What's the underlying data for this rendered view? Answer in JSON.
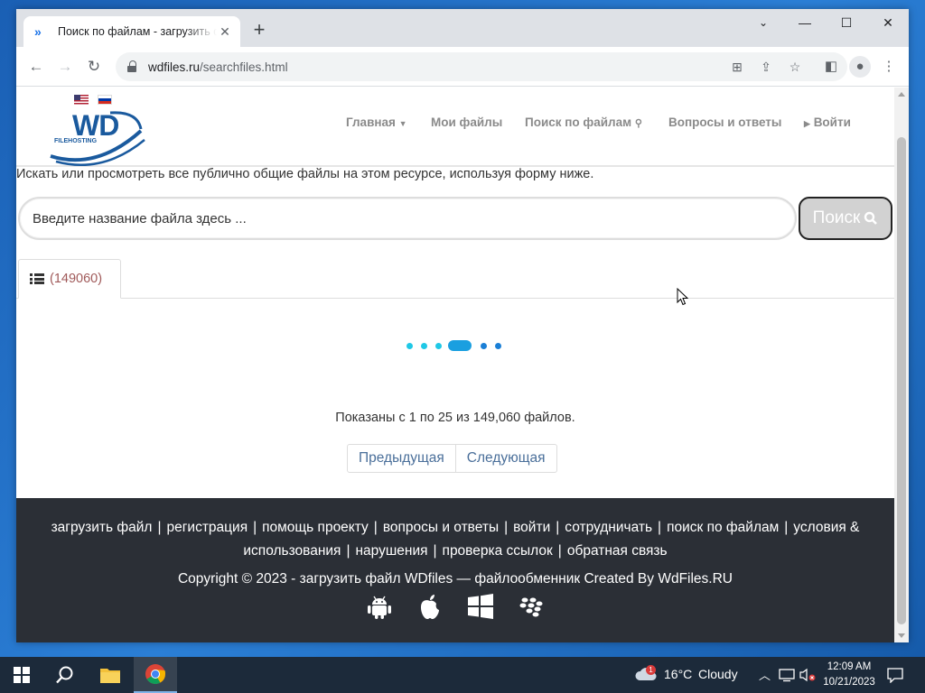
{
  "browser": {
    "tab_title": "Поиск по файлам - загрузить файл",
    "url_host": "wdfiles.ru",
    "url_path": "/searchfiles.html"
  },
  "site": {
    "logo_text": "WD",
    "logo_subtext": "FILEHOSTING",
    "nav": {
      "home": "Главная",
      "my_files": "Мои файлы",
      "search": "Поиск по файлам",
      "faq": "Вопросы и ответы",
      "login": "Войти"
    },
    "intro": "Искать или просмотреть все публично общие файлы на этом ресурсе, используя форму ниже.",
    "search": {
      "placeholder": "Введите название файла здесь ...",
      "button": "Поиск"
    },
    "file_count_tab": "(149060)",
    "results_summary": "Показаны с 1 по 25 из 149,060 файлов.",
    "pager": {
      "prev": "Предыдущая",
      "next": "Следующая"
    },
    "footer": {
      "links": [
        "загрузить файл",
        "регистрация",
        "помощь проекту",
        "вопросы и ответы",
        "войти",
        "сотрудничать",
        "поиск по файлам",
        "условия & использования",
        "нарушения",
        "проверка ссылок",
        "обратная связь"
      ],
      "copyright": "Copyright © 2023 - загрузить файл WDfiles — файлообменник Created By WdFiles.RU",
      "os_icons": [
        "android-icon",
        "apple-icon",
        "windows-icon",
        "blackberry-icon"
      ]
    }
  },
  "taskbar": {
    "weather_temp": "16°C",
    "weather_text": "Cloudy",
    "weather_badge": "1",
    "time": "12:09 AM",
    "date": "10/21/2023"
  },
  "colors": {
    "logo_blue": "#1a5a9e",
    "footer_bg": "#2b2f36",
    "pager_link": "#4a6f9a",
    "loader_cyan": "#1fc8e6",
    "loader_blue": "#1a7fd6"
  }
}
